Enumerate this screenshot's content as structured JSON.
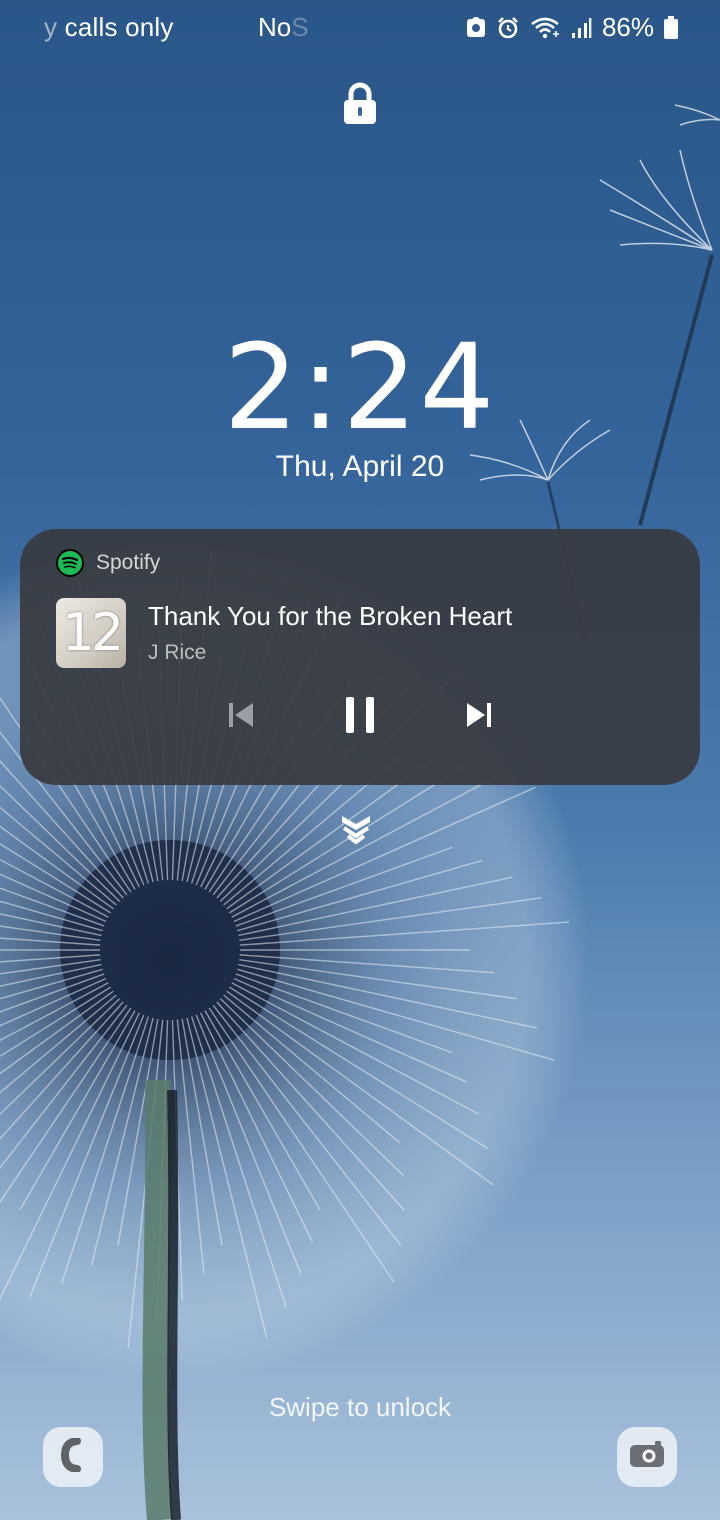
{
  "status_bar": {
    "carrier_prefix": "y",
    "carrier": "calls only",
    "sim_status": "No",
    "sim_status_fade": "S",
    "battery_percent": "86%",
    "icons": [
      "vpn-icon",
      "alarm-icon",
      "wifi-icon",
      "signal-icon",
      "battery-icon"
    ]
  },
  "lock": {
    "icon": "lock-icon"
  },
  "clock": {
    "time": "2:24",
    "date": "Thu, April 20"
  },
  "media_notification": {
    "app_name": "Spotify",
    "album_art_text": "12",
    "track_title": "Thank You for the Broken Heart",
    "artist": "J Rice",
    "controls": [
      "previous-icon",
      "pause-icon",
      "next-icon"
    ],
    "accent_color": "#1db954"
  },
  "hint": {
    "swipe_text": "Swipe to unlock"
  },
  "shortcuts": {
    "left": "phone-icon",
    "right": "camera-icon"
  }
}
